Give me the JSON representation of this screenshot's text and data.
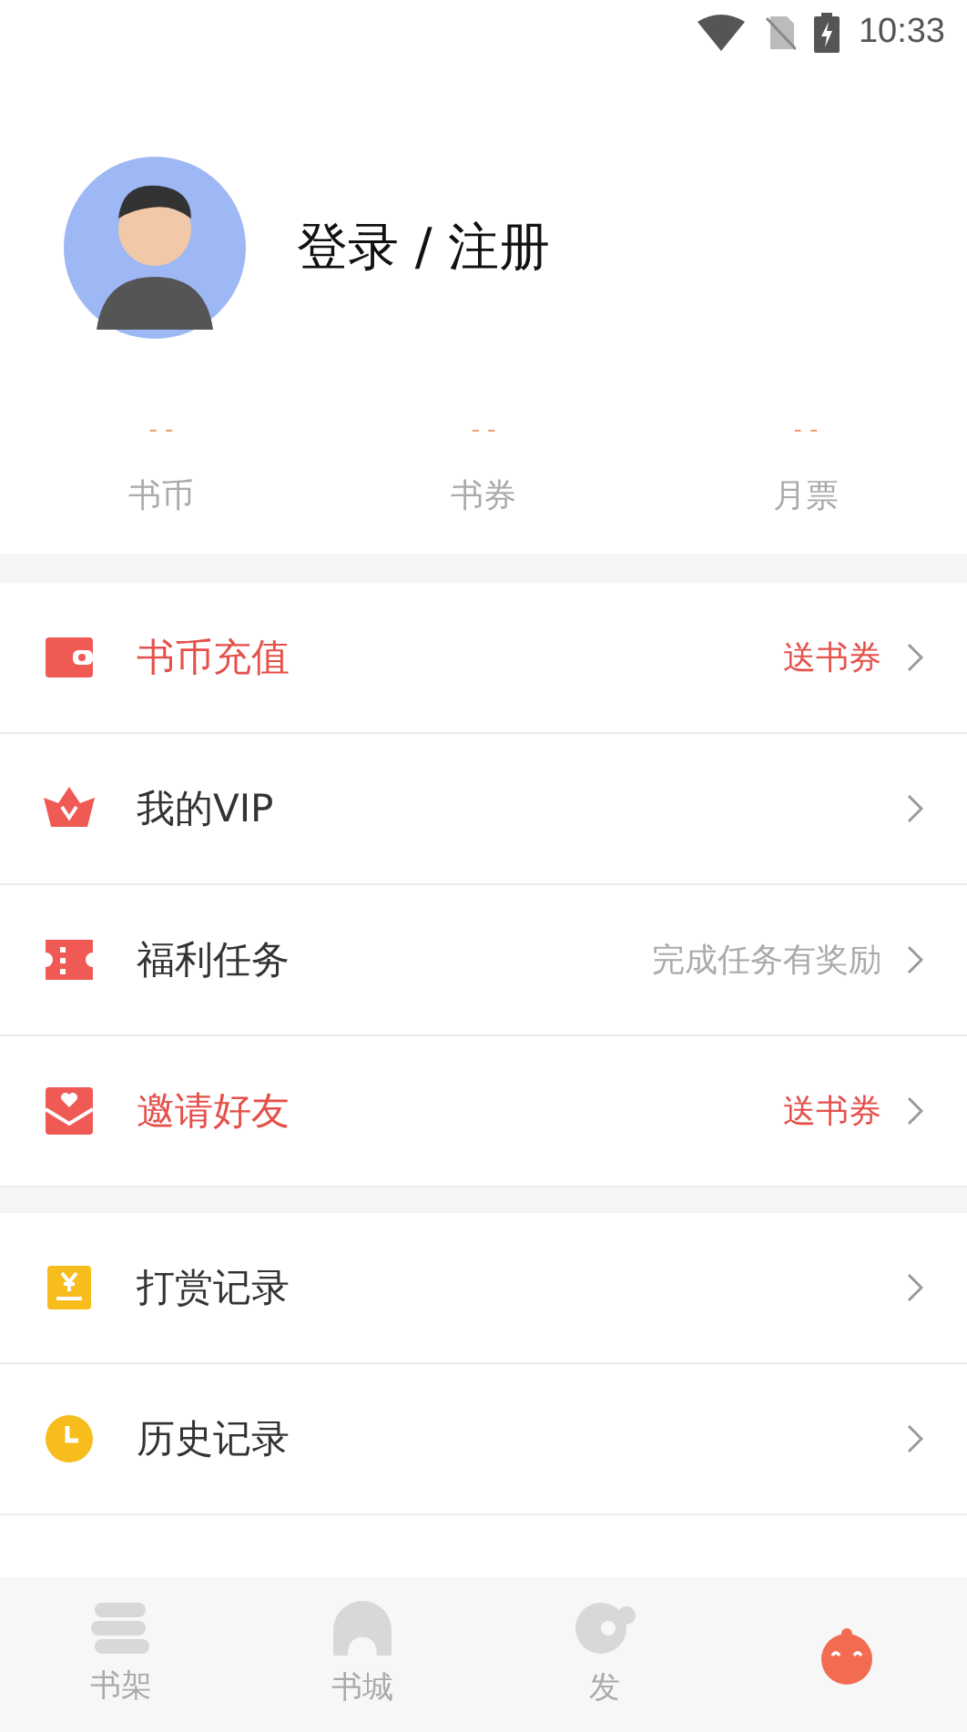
{
  "status_bar": {
    "time": "10:33"
  },
  "profile": {
    "login_label": "登录 / 注册"
  },
  "stats": [
    {
      "value": "- -",
      "label": "书币"
    },
    {
      "value": "- -",
      "label": "书券"
    },
    {
      "value": "- -",
      "label": "月票"
    }
  ],
  "menu_groups": [
    [
      {
        "label": "书币充值",
        "highlighted": true,
        "note": "送书券"
      },
      {
        "label": "我的VIP",
        "highlighted": false
      },
      {
        "label": "福利任务",
        "highlighted": false,
        "note": "完成任务有奖励"
      },
      {
        "label": "邀请好友",
        "highlighted": true,
        "note": "送书券"
      }
    ],
    [
      {
        "label": "打赏记录",
        "highlighted": false
      },
      {
        "label": "历史记录",
        "highlighted": false
      }
    ]
  ],
  "bottom_nav": [
    {
      "label": "书架",
      "selected": false
    },
    {
      "label": "书城",
      "selected": false
    },
    {
      "label": "发",
      "selected": false
    },
    {
      "selected": true
    }
  ]
}
